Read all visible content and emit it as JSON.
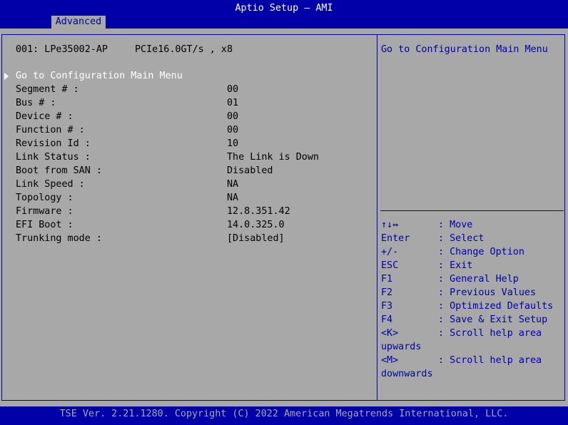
{
  "window": {
    "title": "Aptio Setup – AMI",
    "tab": "Advanced"
  },
  "device": {
    "header_id": "001: LPe35002-AP",
    "header_speed": "PCIe16.0GT/s , x8",
    "goto_label": "Go to Configuration Main Menu",
    "fields": [
      {
        "label": "Segment # :",
        "value": "00"
      },
      {
        "label": "Bus # :",
        "value": "01"
      },
      {
        "label": "Device # :",
        "value": "00"
      },
      {
        "label": "Function # :",
        "value": "00"
      },
      {
        "label": "Revision Id :",
        "value": "10"
      },
      {
        "label": "Link Status :",
        "value": "The Link is Down"
      },
      {
        "label": "Boot from SAN :",
        "value": "Disabled"
      },
      {
        "label": "Link Speed :",
        "value": "NA"
      },
      {
        "label": "Topology :",
        "value": "NA"
      },
      {
        "label": "Firmware :",
        "value": "12.8.351.42"
      },
      {
        "label": "EFI Boot :",
        "value": "14.0.325.0"
      },
      {
        "label": "Trunking mode :",
        "value": "[Disabled]"
      }
    ]
  },
  "help": {
    "text": "Go to Configuration Main Menu"
  },
  "keys": [
    {
      "key": "↑↓↔",
      "desc": ": Move"
    },
    {
      "key": "Enter",
      "desc": ": Select"
    },
    {
      "key": "+/-",
      "desc": ": Change Option"
    },
    {
      "key": "ESC",
      "desc": ": Exit"
    },
    {
      "key": "F1",
      "desc": ": General Help"
    },
    {
      "key": "F2",
      "desc": ": Previous Values"
    },
    {
      "key": "F3",
      "desc": ": Optimized Defaults"
    },
    {
      "key": "F4",
      "desc": ": Save & Exit Setup"
    },
    {
      "key": "<K>",
      "desc": ": Scroll help area"
    },
    {
      "key": "upwards",
      "desc": ""
    },
    {
      "key": "<M>",
      "desc": ": Scroll help area"
    },
    {
      "key": "downwards",
      "desc": ""
    }
  ],
  "footer": {
    "text": "TSE Ver. 2.21.1280. Copyright (C) 2022 American Megatrends International, LLC."
  },
  "colors": {
    "bios_blue": "#0000a8",
    "bios_gray": "#a8a8a8",
    "highlight_white": "#ffffff"
  }
}
